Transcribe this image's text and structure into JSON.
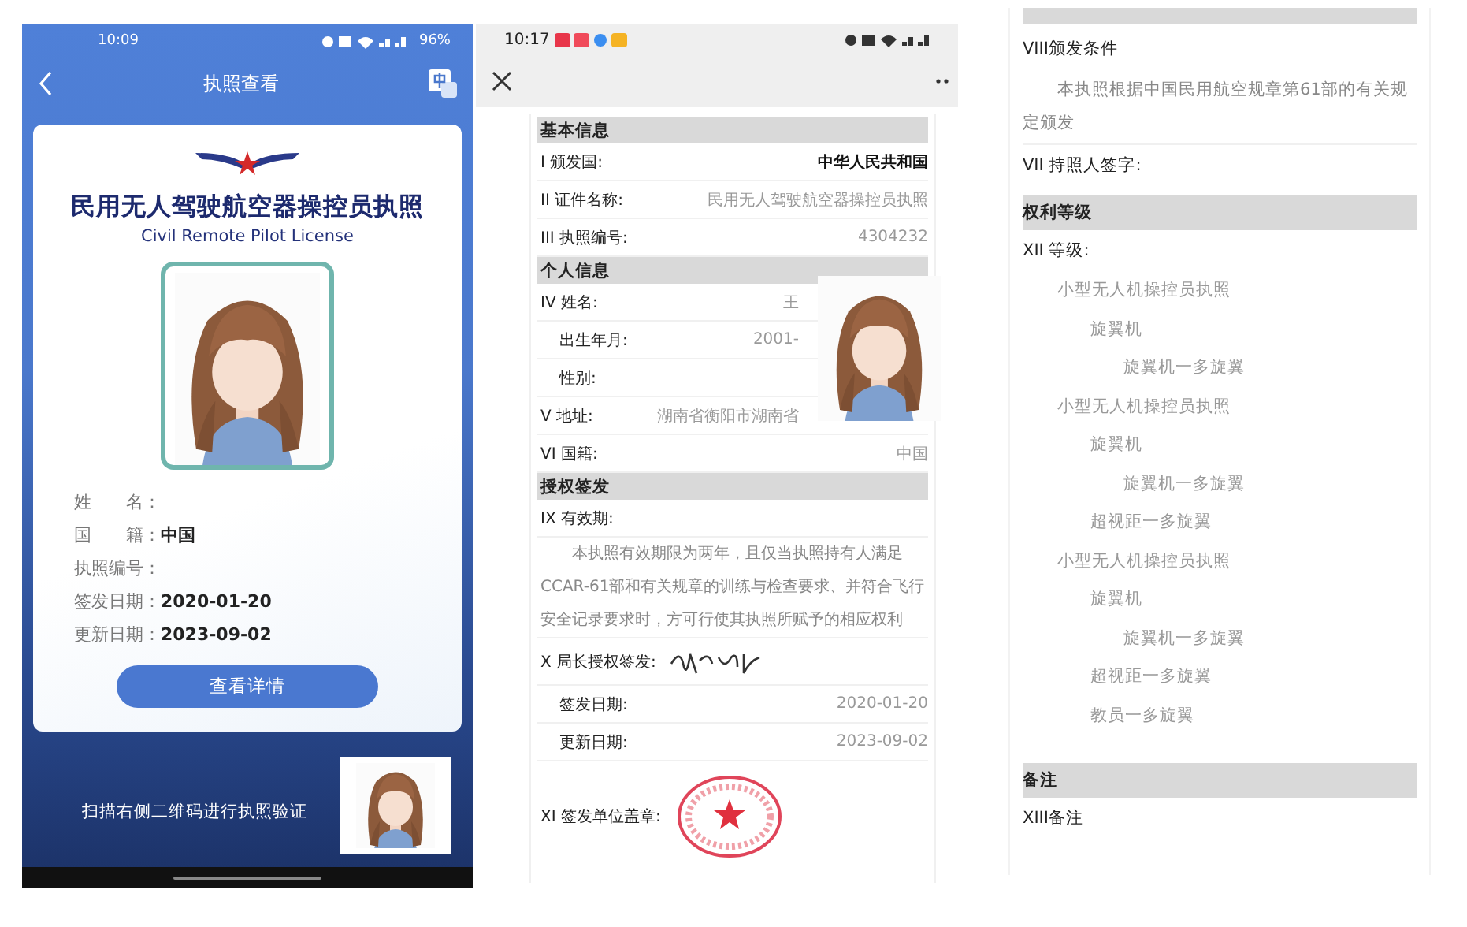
{
  "license_app": {
    "status_bar": {
      "time": "10:09",
      "battery": "96%"
    },
    "title": "执照查看",
    "card": {
      "title_zh": "民用无人驾驶航空器操控员执照",
      "title_en": "Civil Remote Pilot License",
      "fields": [
        {
          "label": "姓　　名："
        },
        {
          "label": "国　　籍：",
          "value": "中国"
        },
        {
          "label": "执照编号："
        },
        {
          "label": "签发日期：",
          "value": "2020-01-20"
        },
        {
          "label": "更新日期：",
          "value": "2023-09-02"
        }
      ],
      "button": "查看详情"
    },
    "footer": "扫描右侧二维码进行执照验证"
  },
  "detail_page": {
    "status_bar": {
      "time": "10:17"
    },
    "sections": [
      {
        "heading": "基本信息",
        "rows": [
          {
            "kind": "row",
            "label": "I 颁发国:",
            "value": "中华人民共和国",
            "emphasis": true
          },
          {
            "kind": "row",
            "label": "II 证件名称:",
            "value": "民用无人驾驶航空器操控员执照",
            "emphasis": false
          },
          {
            "kind": "row",
            "label": "III 执照编号:",
            "value": "4304232",
            "emphasis": false
          }
        ]
      },
      {
        "heading": "个人信息",
        "rows": [
          {
            "kind": "row",
            "label": "IV 姓名:",
            "value": "王",
            "emphasis": false
          },
          {
            "kind": "subrow",
            "label": "出生年月:",
            "value": "2001-",
            "emphasis": false
          },
          {
            "kind": "subrow",
            "label": "性别:"
          },
          {
            "kind": "row",
            "label": "V  地址:",
            "value": "湖南省衡阳市湖南省",
            "emphasis": false
          },
          {
            "kind": "row",
            "label": "VI 国籍:",
            "value": "中国",
            "emphasis": false
          }
        ]
      },
      {
        "heading": "授权签发",
        "rows": [
          {
            "kind": "label",
            "label": "IX 有效期:"
          },
          {
            "kind": "paragraph",
            "text": "本执照有效期限为两年，且仅当执照持有人满足CCAR-61部和有关规章的训练与检查要求、并符合飞行安全记录要求时，方可行使其执照所赋予的相应权利"
          },
          {
            "kind": "signature",
            "label": "X  局长授权签发:"
          },
          {
            "kind": "subrow",
            "label": "签发日期:",
            "value": "2020-01-20",
            "emphasis": false
          },
          {
            "kind": "subrow",
            "label": "更新日期:",
            "value": "2023-09-02",
            "emphasis": false
          },
          {
            "kind": "seal",
            "label": "XI 签发单位盖章:"
          }
        ]
      }
    ]
  },
  "detail_page_continued": {
    "condition_title": "VIII颁发条件",
    "condition_text": "本执照根据中国民用航空规章第61部的有关规定颁发",
    "holder_signature": "VII  持照人签字:",
    "rights_heading": "权利等级",
    "grade_label": "XII 等级:",
    "grades": [
      {
        "label": "小型无人机操控员执照",
        "children": [
          {
            "label": "旋翼机",
            "children": [
              {
                "label": "旋翼机一多旋翼"
              }
            ]
          }
        ]
      },
      {
        "label": "小型无人机操控员执照",
        "children": [
          {
            "label": "旋翼机",
            "children": [
              {
                "label": "旋翼机一多旋翼"
              }
            ]
          },
          {
            "label": "超视距一多旋翼"
          }
        ]
      },
      {
        "label": "小型无人机操控员执照",
        "children": [
          {
            "label": "旋翼机",
            "children": [
              {
                "label": "旋翼机一多旋翼"
              }
            ]
          },
          {
            "label": "超视距一多旋翼"
          },
          {
            "label": "教员一多旋翼"
          }
        ]
      }
    ],
    "notes_heading": "备注",
    "notes_label": "XIII备注"
  }
}
